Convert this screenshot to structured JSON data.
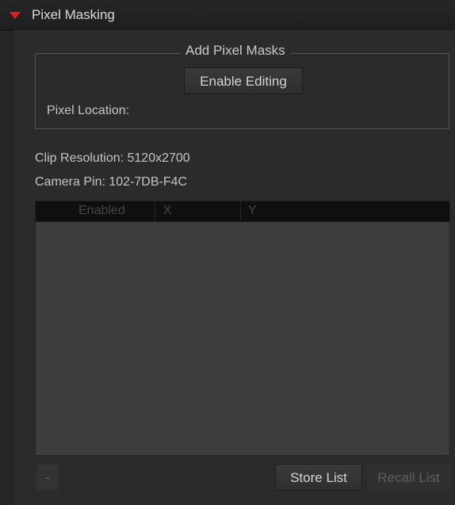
{
  "panel": {
    "title": "Pixel Masking",
    "collapse_icon": "triangle-down-icon",
    "accent_color": "#e8161e"
  },
  "add_pixel_masks": {
    "legend": "Add Pixel Masks",
    "enable_editing_label": "Enable Editing",
    "pixel_location_label": "Pixel Location:"
  },
  "info": {
    "clip_resolution": "Clip Resolution:  5120x2700",
    "camera_pin": "Camera Pin:  102-7DB-F4C"
  },
  "mask_table": {
    "columns": [
      "Enabled",
      "X",
      "Y"
    ],
    "rows": []
  },
  "footer": {
    "minus_label": "-",
    "store_label": "Store List",
    "recall_label": "Recall List"
  }
}
